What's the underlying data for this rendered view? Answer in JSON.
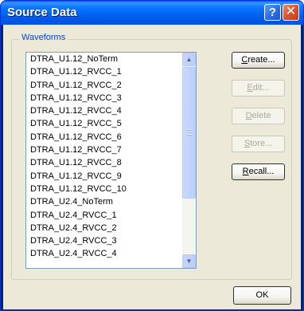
{
  "window": {
    "title": "Source Data"
  },
  "titlebar": {
    "help_glyph": "?",
    "close_glyph": "✕"
  },
  "waveforms": {
    "label": "Waveforms",
    "items": [
      "DTRA_U1.12_NoTerm",
      "DTRA_U1.12_RVCC_1",
      "DTRA_U1.12_RVCC_2",
      "DTRA_U1.12_RVCC_3",
      "DTRA_U1.12_RVCC_4",
      "DTRA_U1.12_RVCC_5",
      "DTRA_U1.12_RVCC_6",
      "DTRA_U1.12_RVCC_7",
      "DTRA_U1.12_RVCC_8",
      "DTRA_U1.12_RVCC_9",
      "DTRA_U1.12_RVCC_10",
      "DTRA_U2.4_NoTerm",
      "DTRA_U2.4_RVCC_1",
      "DTRA_U2.4_RVCC_2",
      "DTRA_U2.4_RVCC_3",
      "DTRA_U2.4_RVCC_4"
    ]
  },
  "buttons": {
    "create": {
      "accel": "C",
      "rest": "reate..."
    },
    "edit": {
      "accel": "E",
      "rest": "dit..."
    },
    "delete": {
      "accel": "D",
      "rest": "elete"
    },
    "store": {
      "accel": "S",
      "rest": "tore..."
    },
    "recall": {
      "accel": "R",
      "rest": "ecall..."
    },
    "ok": "OK"
  },
  "scrollbar": {
    "up_glyph": "▲",
    "down_glyph": "▼"
  }
}
